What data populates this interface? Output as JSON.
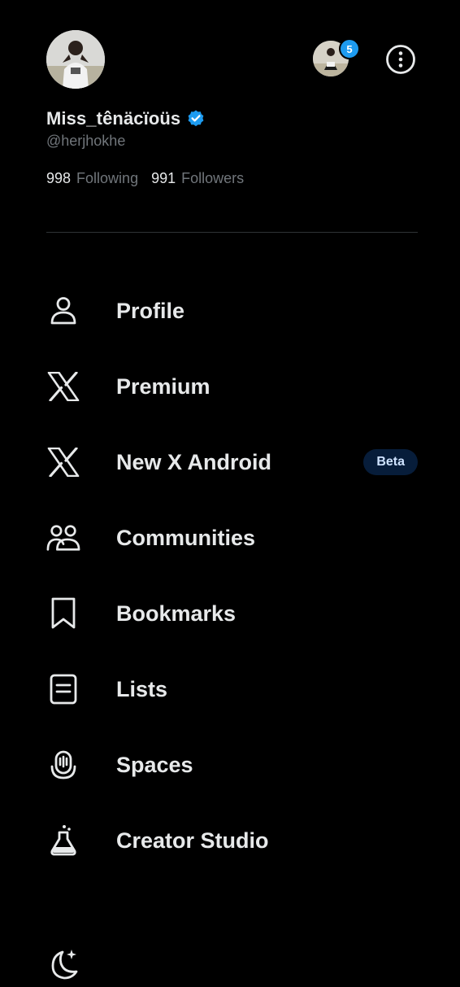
{
  "profile": {
    "display_name": "Miss_tênäcïoüs",
    "handle": "@herjhokhe",
    "following_count": "998",
    "following_label": "Following",
    "followers_count": "991",
    "followers_label": "Followers",
    "verified": true
  },
  "account_switcher": {
    "notification_count": "5"
  },
  "menu": [
    {
      "label": "Profile",
      "icon": "person-icon"
    },
    {
      "label": "Premium",
      "icon": "x-logo-icon"
    },
    {
      "label": "New X Android",
      "icon": "x-logo-icon",
      "badge": "Beta"
    },
    {
      "label": "Communities",
      "icon": "communities-icon"
    },
    {
      "label": "Bookmarks",
      "icon": "bookmark-icon"
    },
    {
      "label": "Lists",
      "icon": "list-icon"
    },
    {
      "label": "Spaces",
      "icon": "spaces-icon"
    },
    {
      "label": "Creator Studio",
      "icon": "flask-icon"
    }
  ],
  "colors": {
    "background": "#000000",
    "text": "#e7e9ea",
    "muted": "#71767b",
    "accent": "#1d9bf0",
    "beta_bg": "#071d3a"
  }
}
